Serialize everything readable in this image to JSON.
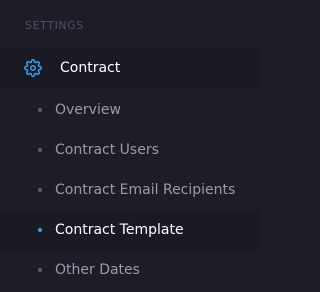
{
  "section": {
    "title": "SETTINGS"
  },
  "menu": {
    "parent": {
      "label": "Contract",
      "icon": "gear-icon",
      "icon_color": "#3b9ee8"
    },
    "items": [
      {
        "label": "Overview",
        "active": false
      },
      {
        "label": "Contract Users",
        "active": false
      },
      {
        "label": "Contract Email Recipients",
        "active": false
      },
      {
        "label": "Contract Template",
        "active": true
      },
      {
        "label": "Other Dates",
        "active": false
      }
    ]
  },
  "colors": {
    "background": "#1d1d28",
    "active_background": "#1a1a24",
    "active_bullet": "#3b9ee8",
    "inactive_text": "#9a9baa",
    "active_text": "#ffffff"
  }
}
